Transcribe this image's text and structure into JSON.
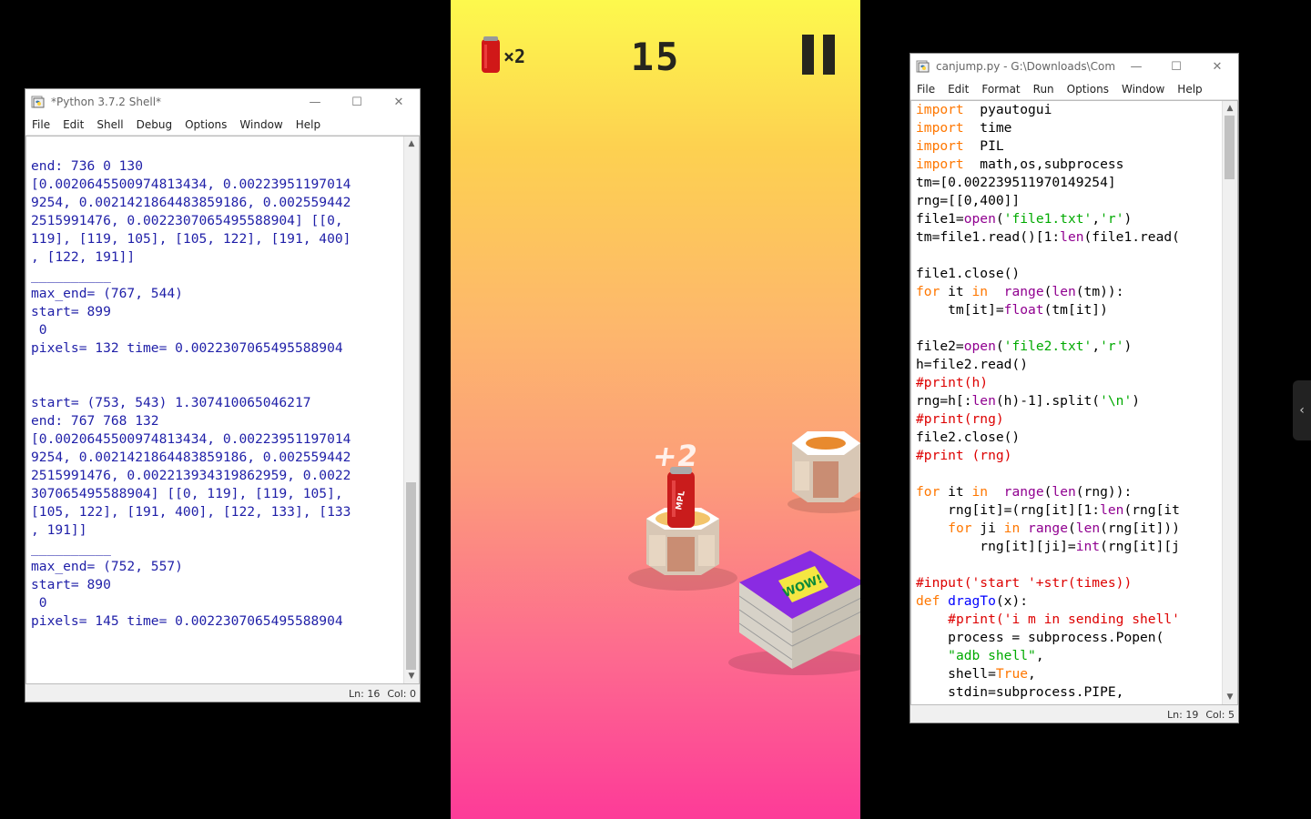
{
  "shell_window": {
    "title": "*Python 3.7.2 Shell*",
    "menu": [
      "File",
      "Edit",
      "Shell",
      "Debug",
      "Options",
      "Window",
      "Help"
    ],
    "lines": [
      "end: 736 0 130",
      "[0.0020645500974813434, 0.00223951197014",
      "9254, 0.0021421864483859186, 0.002559442",
      "2515991476, 0.0022307065495588904] [[0,",
      "119], [119, 105], [105, 122], [191, 400]",
      ", [122, 191]]",
      "__________",
      "max_end= (767, 544)",
      "start= 899",
      " 0",
      "pixels= 132 time= 0.0022307065495588904",
      "",
      "",
      "start= (753, 543) 1.307410065046217",
      "end: 767 768 132",
      "[0.0020645500974813434, 0.00223951197014",
      "9254, 0.0021421864483859186, 0.002559442",
      "2515991476, 0.002213934319862959, 0.0022",
      "307065495588904] [[0, 119], [119, 105],",
      "[105, 122], [191, 400], [122, 133], [133",
      ", 191]]",
      "__________",
      "max_end= (752, 557)",
      "start= 890",
      " 0",
      "pixels= 145 time= 0.0022307065495588904"
    ],
    "status_ln": "Ln: 16",
    "status_col": "Col: 0"
  },
  "editor_window": {
    "title": "canjump.py - G:\\Downloads\\Com...",
    "menu": [
      "File",
      "Edit",
      "Format",
      "Run",
      "Options",
      "Window",
      "Help"
    ],
    "code": [
      [
        [
          "kw",
          "import"
        ],
        [
          "",
          "  pyautogui"
        ]
      ],
      [
        [
          "kw",
          "import"
        ],
        [
          "",
          "  time"
        ]
      ],
      [
        [
          "kw",
          "import"
        ],
        [
          "",
          "  PIL"
        ]
      ],
      [
        [
          "kw",
          "import"
        ],
        [
          "",
          "  math,os,subprocess"
        ]
      ],
      [
        [
          "",
          "tm=[0.002239511970149254]"
        ]
      ],
      [
        [
          "",
          "rng=[[0,400]]"
        ]
      ],
      [
        [
          "",
          "file1="
        ],
        [
          "bi",
          "open"
        ],
        [
          "",
          "("
        ],
        [
          "str",
          "'file1.txt'"
        ],
        [
          "",
          ","
        ],
        [
          "str",
          "'r'"
        ],
        [
          "",
          ")"
        ]
      ],
      [
        [
          "",
          "tm=file1.read()[1:"
        ],
        [
          "bi",
          "len"
        ],
        [
          "",
          "(file1.read("
        ]
      ],
      [
        [
          "",
          ""
        ]
      ],
      [
        [
          "",
          "file1.close()"
        ]
      ],
      [
        [
          "kw",
          "for"
        ],
        [
          "",
          " it "
        ],
        [
          "kw",
          "in"
        ],
        [
          "",
          "  "
        ],
        [
          "bi",
          "range"
        ],
        [
          "",
          "("
        ],
        [
          "bi",
          "len"
        ],
        [
          "",
          "(tm)):"
        ]
      ],
      [
        [
          "",
          "    tm[it]="
        ],
        [
          "bi",
          "float"
        ],
        [
          "",
          "(tm[it])"
        ]
      ],
      [
        [
          "",
          ""
        ]
      ],
      [
        [
          "",
          "file2="
        ],
        [
          "bi",
          "open"
        ],
        [
          "",
          "("
        ],
        [
          "str",
          "'file2.txt'"
        ],
        [
          "",
          ","
        ],
        [
          "str",
          "'r'"
        ],
        [
          "",
          ")"
        ]
      ],
      [
        [
          "",
          "h=file2.read()"
        ]
      ],
      [
        [
          "com",
          "#print(h)"
        ]
      ],
      [
        [
          "",
          "rng=h[:"
        ],
        [
          "bi",
          "len"
        ],
        [
          "",
          "(h)-1].split("
        ],
        [
          "str",
          "'\\n'"
        ],
        [
          "",
          ")"
        ]
      ],
      [
        [
          "com",
          "#print(rng)"
        ]
      ],
      [
        [
          "",
          "file2.close()"
        ]
      ],
      [
        [
          "com",
          "#print (rng)"
        ]
      ],
      [
        [
          "",
          ""
        ]
      ],
      [
        [
          "kw",
          "for"
        ],
        [
          "",
          " it "
        ],
        [
          "kw",
          "in"
        ],
        [
          "",
          "  "
        ],
        [
          "bi",
          "range"
        ],
        [
          "",
          "("
        ],
        [
          "bi",
          "len"
        ],
        [
          "",
          "(rng)):"
        ]
      ],
      [
        [
          "",
          "    rng[it]=(rng[it][1:"
        ],
        [
          "bi",
          "len"
        ],
        [
          "",
          "(rng[it"
        ]
      ],
      [
        [
          "",
          "    "
        ],
        [
          "kw",
          "for"
        ],
        [
          "",
          " ji "
        ],
        [
          "kw",
          "in"
        ],
        [
          "",
          " "
        ],
        [
          "bi",
          "range"
        ],
        [
          "",
          "("
        ],
        [
          "bi",
          "len"
        ],
        [
          "",
          "(rng[it]))"
        ]
      ],
      [
        [
          "",
          "        rng[it][ji]="
        ],
        [
          "bi",
          "int"
        ],
        [
          "",
          "(rng[it][j"
        ]
      ],
      [
        [
          "",
          ""
        ]
      ],
      [
        [
          "com",
          "#input('start '+str(times))"
        ]
      ],
      [
        [
          "kw",
          "def"
        ],
        [
          "",
          " "
        ],
        [
          "def",
          "dragTo"
        ],
        [
          "",
          "(x):"
        ]
      ],
      [
        [
          "",
          "    "
        ],
        [
          "com",
          "#print('i m in sending shell'"
        ]
      ],
      [
        [
          "",
          "    process = subprocess.Popen("
        ]
      ],
      [
        [
          "",
          "    "
        ],
        [
          "str",
          "\"adb shell\""
        ],
        [
          "",
          ","
        ]
      ],
      [
        [
          "",
          "    shell="
        ],
        [
          "kw",
          "True"
        ],
        [
          "",
          ","
        ]
      ],
      [
        [
          "",
          "    stdin=subprocess.PIPE,"
        ]
      ]
    ],
    "status_ln": "Ln: 19",
    "status_col": "Col: 5"
  },
  "game": {
    "score": "15",
    "can_multiplier": "×2",
    "can_logo": "MPL",
    "popup": "+2",
    "book_text": "WOW!"
  },
  "window_controls": {
    "minimize": "—",
    "maximize": "☐",
    "close": "✕"
  },
  "edge_tab_icon": "‹"
}
